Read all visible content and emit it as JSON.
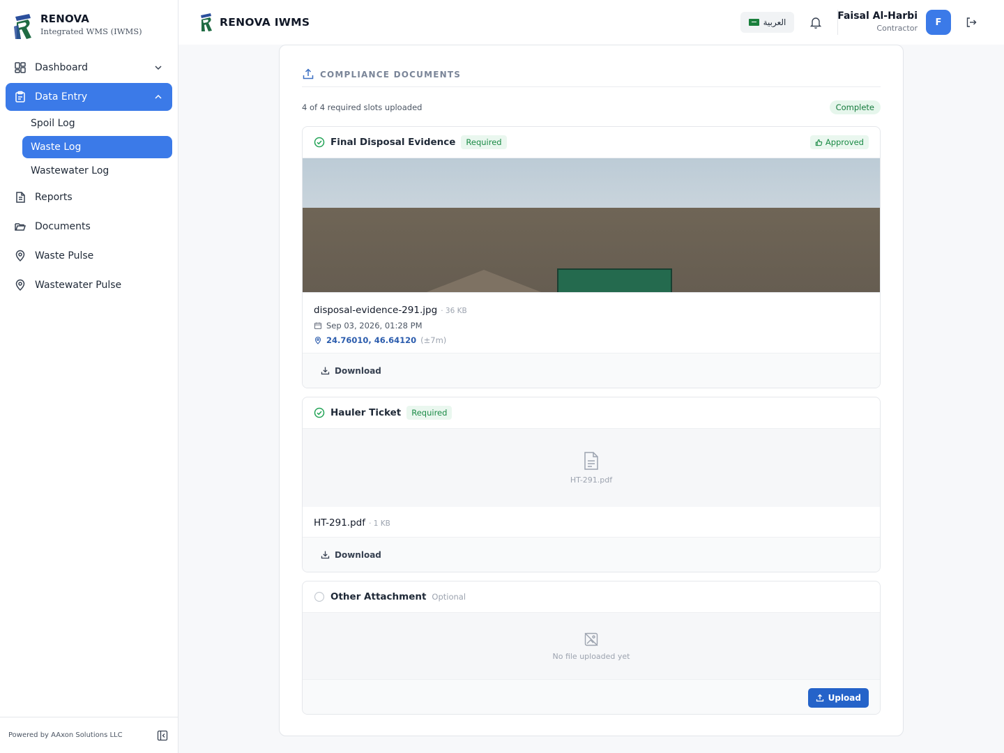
{
  "brand": {
    "name": "RENOVA",
    "subtitle": "Integrated WMS (IWMS)"
  },
  "sidebar": {
    "items": [
      {
        "label": "Dashboard",
        "icon": "dashboard-grid-icon"
      },
      {
        "label": "Data Entry",
        "icon": "clipboard-icon"
      },
      {
        "label": "Reports",
        "icon": "file-text-icon"
      },
      {
        "label": "Documents",
        "icon": "folder-open-icon"
      },
      {
        "label": "Waste Pulse",
        "icon": "map-pin-icon"
      },
      {
        "label": "Wastewater Pulse",
        "icon": "map-pin-icon"
      }
    ],
    "subitems": [
      {
        "label": "Spoil Log"
      },
      {
        "label": "Waste Log"
      },
      {
        "label": "Wastewater Log"
      }
    ],
    "footer": "Powered by AAxon Solutions LLC"
  },
  "header": {
    "title": "RENOVA IWMS",
    "language_button": "العربية",
    "user_name": "Faisal Al-Harbi",
    "user_role": "Contractor",
    "avatar_initial": "F"
  },
  "compliance": {
    "section_title": "COMPLIANCE DOCUMENTS",
    "slots_text": "4 of 4 required slots uploaded",
    "status_badge": "Complete",
    "slots": [
      {
        "title": "Final Disposal Evidence",
        "badge": "Required",
        "approval": "Approved",
        "file_name": "disposal-evidence-291.jpg",
        "file_size": "· 36 KB",
        "timestamp": "Sep 03, 2026, 01:28 PM",
        "coordinates": "24.76010, 46.64120",
        "accuracy": "(±7m)",
        "action": "Download"
      },
      {
        "title": "Hauler Ticket",
        "badge": "Required",
        "preview_label": "HT-291.pdf",
        "file_name": "HT-291.pdf",
        "file_size": "· 1 KB",
        "action": "Download"
      },
      {
        "title": "Other Attachment",
        "badge": "Optional",
        "preview_label": "No file uploaded yet",
        "action": "Upload"
      }
    ]
  },
  "colors": {
    "accent": "#3b7ae8",
    "success": "#1a8a45",
    "primary_button": "#2563c9"
  }
}
